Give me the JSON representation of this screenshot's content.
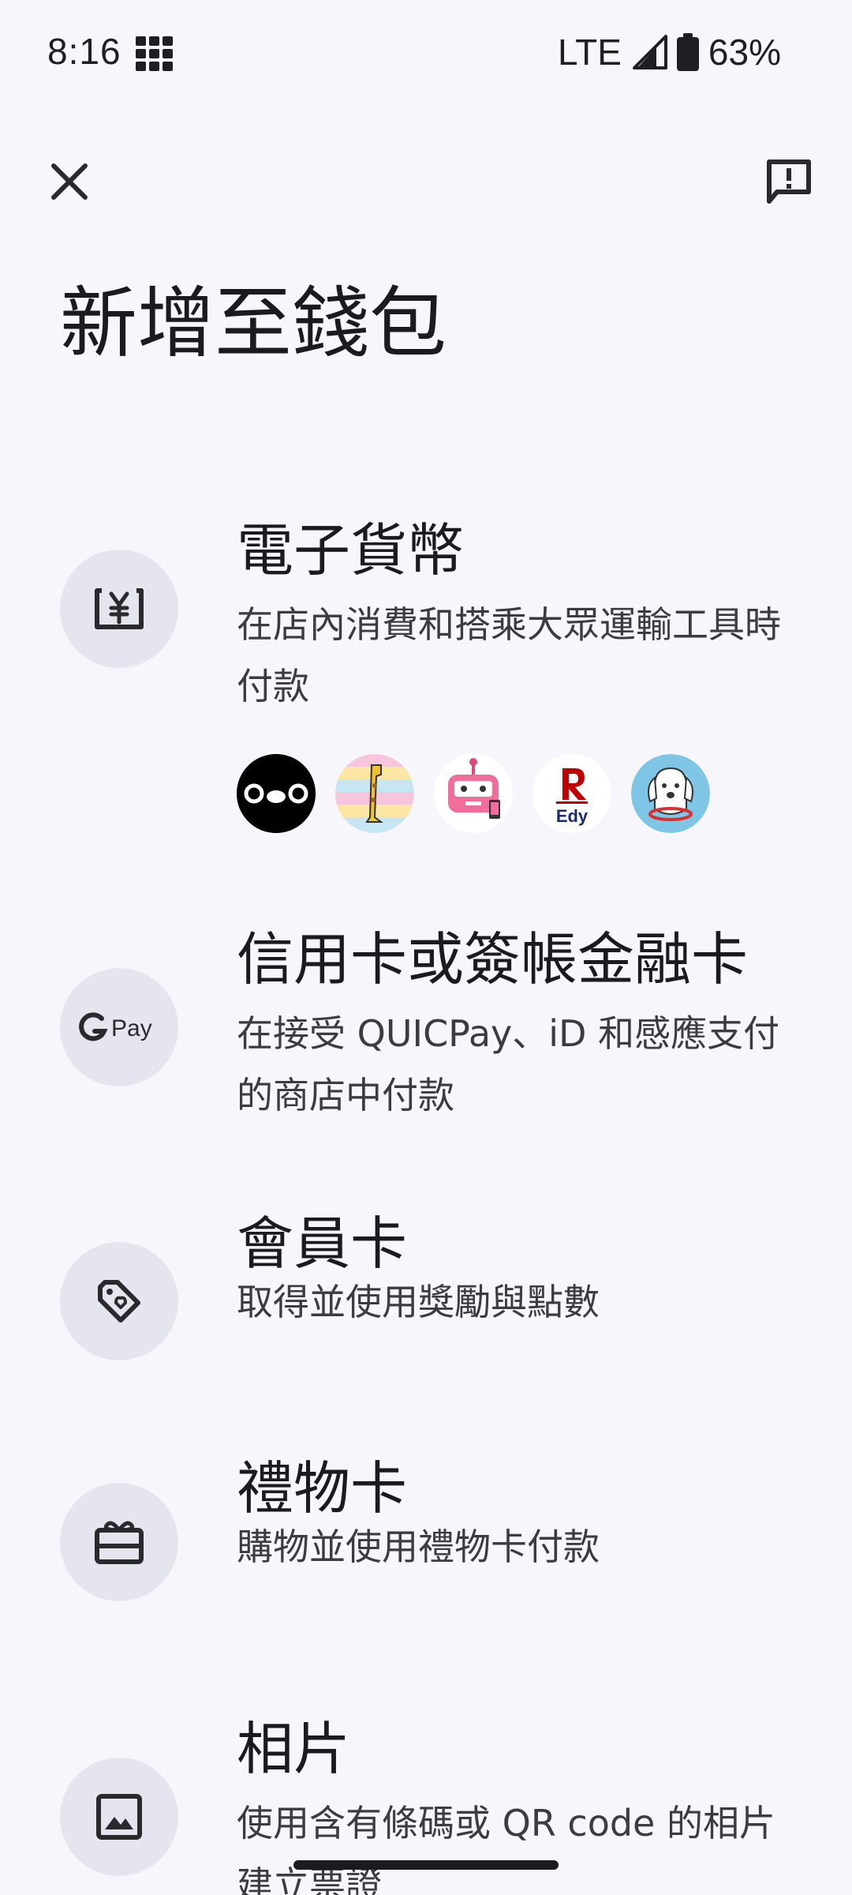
{
  "status_bar": {
    "time": "8:16",
    "network": "LTE",
    "battery": "63%",
    "icons": [
      "grid-icon",
      "signal-icon",
      "battery-icon"
    ]
  },
  "top_bar": {
    "close_icon": "close-icon",
    "feedback_icon": "feedback-icon"
  },
  "page_title": "新增至錢包",
  "options": [
    {
      "id": "e-money",
      "icon": "yen-icon",
      "title": "電子貨幣",
      "description": "在店內消費和搭乘大眾運輸工具時付款",
      "brand_logos": [
        "suica-penguin-logo",
        "manaca-giraffe-logo",
        "nanaco-robot-logo",
        "rakuten-edy-logo",
        "waon-dog-logo"
      ],
      "edy_text": "Edy"
    },
    {
      "id": "credit-debit",
      "icon": "gpay-icon",
      "icon_text": "Pay",
      "title": "信用卡或簽帳金融卡",
      "description": "在接受 QUICPay、iD 和感應支付的商店中付款"
    },
    {
      "id": "loyalty",
      "icon": "loyalty-tag-icon",
      "title": "會員卡",
      "description": "取得並使用獎勵與點數"
    },
    {
      "id": "gift",
      "icon": "gift-card-icon",
      "title": "禮物卡",
      "description": "購物並使用禮物卡付款"
    },
    {
      "id": "photo",
      "icon": "photo-icon",
      "title": "相片",
      "description": "使用含有條碼或 QR code 的相片建立票證"
    }
  ],
  "colors": {
    "background": "#f6f6fc",
    "icon_circle": "#e5e5f0",
    "text_primary": "#1b1b1f",
    "text_secondary": "#3b3b40"
  }
}
